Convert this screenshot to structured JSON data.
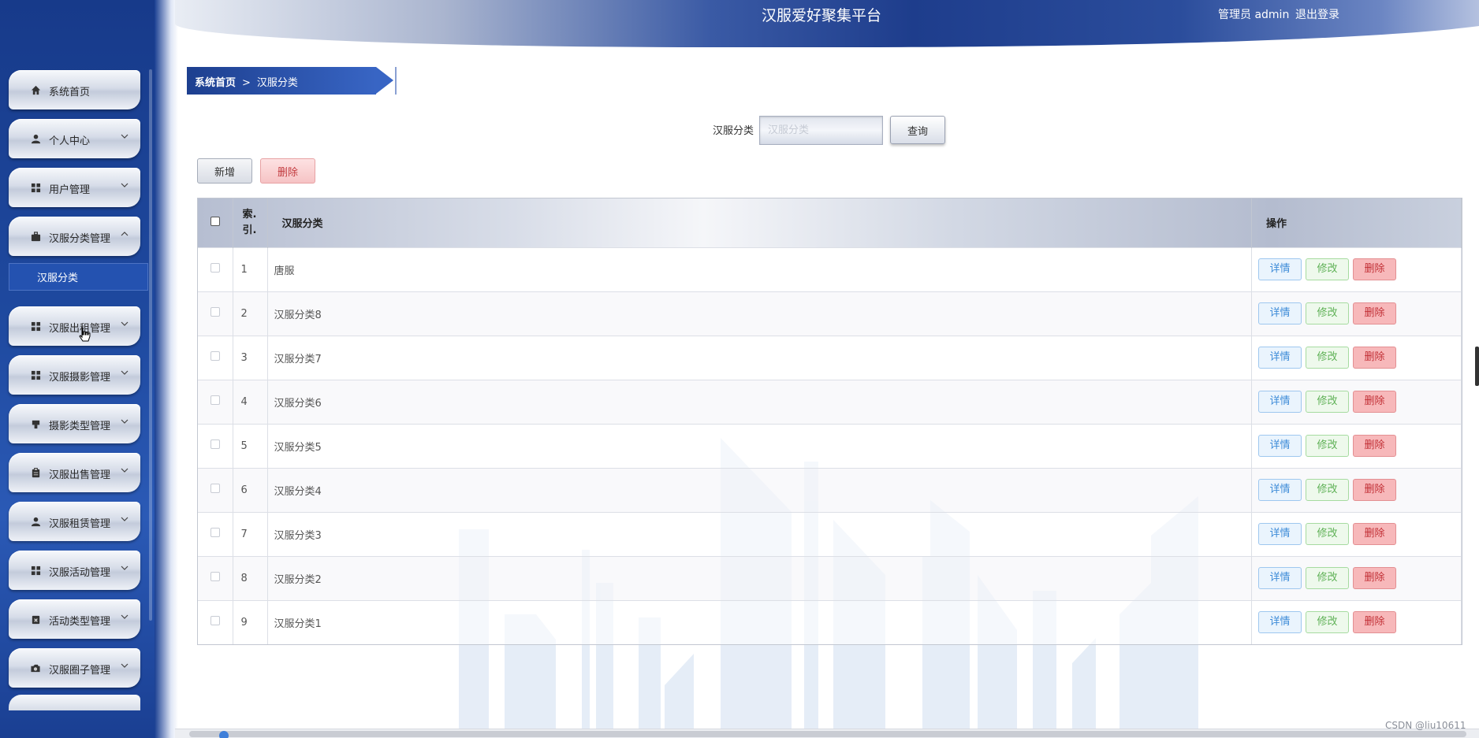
{
  "header": {
    "title": "汉服爱好聚集平台",
    "user_label": "管理员 admin",
    "logout_label": "退出登录"
  },
  "sidebar": {
    "items": [
      {
        "label": "系统首页",
        "icon": "home-icon",
        "expandable": false
      },
      {
        "label": "个人中心",
        "icon": "user-icon",
        "expandable": true
      },
      {
        "label": "用户管理",
        "icon": "grid-icon",
        "expandable": true
      },
      {
        "label": "汉服分类管理",
        "icon": "briefcase-icon",
        "expandable": true,
        "expanded": true
      },
      {
        "label": "汉服出租管理",
        "icon": "grid-icon",
        "expandable": true
      },
      {
        "label": "汉服摄影管理",
        "icon": "grid-icon",
        "expandable": true
      },
      {
        "label": "摄影类型管理",
        "icon": "stamp-icon",
        "expandable": true
      },
      {
        "label": "汉服出售管理",
        "icon": "clipboard-icon",
        "expandable": true
      },
      {
        "label": "汉服租赁管理",
        "icon": "user-icon",
        "expandable": true
      },
      {
        "label": "汉服活动管理",
        "icon": "grid-icon",
        "expandable": true
      },
      {
        "label": "活动类型管理",
        "icon": "clipboard-x-icon",
        "expandable": true
      },
      {
        "label": "汉服圈子管理",
        "icon": "camera-icon",
        "expandable": true
      }
    ],
    "submenu": {
      "label": "汉服分类"
    }
  },
  "breadcrumb": {
    "home": "系统首页",
    "separator": ">",
    "current": "汉服分类"
  },
  "search": {
    "label": "汉服分类",
    "placeholder": "汉服分类",
    "button_label": "查询"
  },
  "actions": {
    "add_label": "新增",
    "delete_label": "删除"
  },
  "table": {
    "columns": {
      "index": "索引",
      "category": "汉服分类",
      "operations": "操作"
    },
    "index_line1": "索.",
    "index_line2": "引.",
    "rows": [
      {
        "index": "1",
        "category": "唐服"
      },
      {
        "index": "2",
        "category": "汉服分类8"
      },
      {
        "index": "3",
        "category": "汉服分类7"
      },
      {
        "index": "4",
        "category": "汉服分类6"
      },
      {
        "index": "5",
        "category": "汉服分类5"
      },
      {
        "index": "6",
        "category": "汉服分类4"
      },
      {
        "index": "7",
        "category": "汉服分类3"
      },
      {
        "index": "8",
        "category": "汉服分类2"
      },
      {
        "index": "9",
        "category": "汉服分类1"
      }
    ],
    "row_buttons": {
      "detail": "详情",
      "edit": "修改",
      "delete": "删除"
    }
  },
  "watermark": "CSDN @liu10611",
  "colors": {
    "sidebar_blue": "#1f4aa0",
    "detail_blue": "#3d8bd8",
    "edit_green": "#5fb156",
    "delete_red": "#c23036"
  }
}
